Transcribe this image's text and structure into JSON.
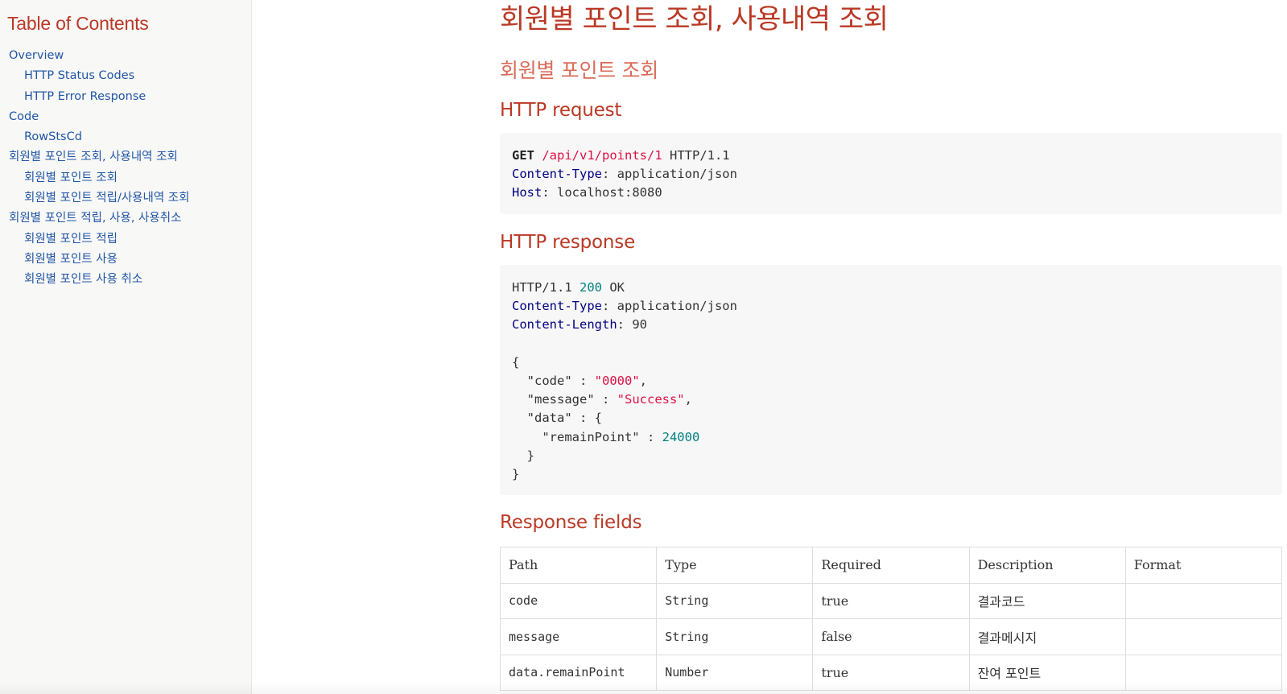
{
  "toc": {
    "title": "Table of Contents",
    "items": [
      {
        "label": "Overview",
        "level": 1
      },
      {
        "label": "HTTP Status Codes",
        "level": 2
      },
      {
        "label": "HTTP Error Response",
        "level": 2
      },
      {
        "label": "Code",
        "level": 1
      },
      {
        "label": "RowStsCd",
        "level": 2
      },
      {
        "label": "회원별 포인트 조회, 사용내역 조회",
        "level": 1
      },
      {
        "label": "회원별 포인트 조회",
        "level": 2
      },
      {
        "label": "회원별 포인트 적립/사용내역 조회",
        "level": 2
      },
      {
        "label": "회원별 포인트 적립, 사용, 사용취소",
        "level": 1
      },
      {
        "label": "회원별 포인트 적립",
        "level": 2
      },
      {
        "label": "회원별 포인트 사용",
        "level": 2
      },
      {
        "label": "회원별 포인트 사용 취소",
        "level": 2
      }
    ]
  },
  "main": {
    "page_title": "회원별 포인트 조회, 사용내역 조회",
    "section_title": "회원별 포인트 조회",
    "request_heading": "HTTP request",
    "request": {
      "method": "GET",
      "path": "/api/v1/points/1",
      "protocol": " HTTP/1.1",
      "headers": [
        {
          "name": "Content-Type",
          "value": "application/json"
        },
        {
          "name": "Host",
          "value": "localhost:8080"
        }
      ]
    },
    "response_heading": "HTTP response",
    "response": {
      "protocol": "HTTP/1.1 ",
      "status_code": "200",
      "status_text": " OK",
      "headers": [
        {
          "name": "Content-Type",
          "value": "application/json"
        },
        {
          "name": "Content-Length",
          "value": "90"
        }
      ],
      "body": {
        "open": "{",
        "code_key": "  \"code\" : ",
        "code_val": "\"0000\"",
        "message_key": "  \"message\" : ",
        "message_val": "\"Success\"",
        "data_open": "  \"data\" : {",
        "remain_key": "    \"remainPoint\" : ",
        "remain_val": "24000",
        "data_close": "  }",
        "close": "}"
      }
    },
    "fields_heading": "Response fields",
    "fields_table": {
      "columns": [
        "Path",
        "Type",
        "Required",
        "Description",
        "Format"
      ],
      "rows": [
        {
          "path": "code",
          "type": "String",
          "required": "true",
          "description": "결과코드",
          "format": ""
        },
        {
          "path": "message",
          "type": "String",
          "required": "false",
          "description": "결과메시지",
          "format": ""
        },
        {
          "path": "data.remainPoint",
          "type": "Number",
          "required": "true",
          "description": "잔여 포인트",
          "format": ""
        }
      ]
    }
  },
  "colors": {
    "heading": "#ba3925",
    "link": "#2156a5",
    "code_string": "#dd1144",
    "code_header": "#000080",
    "code_number": "#008080"
  }
}
